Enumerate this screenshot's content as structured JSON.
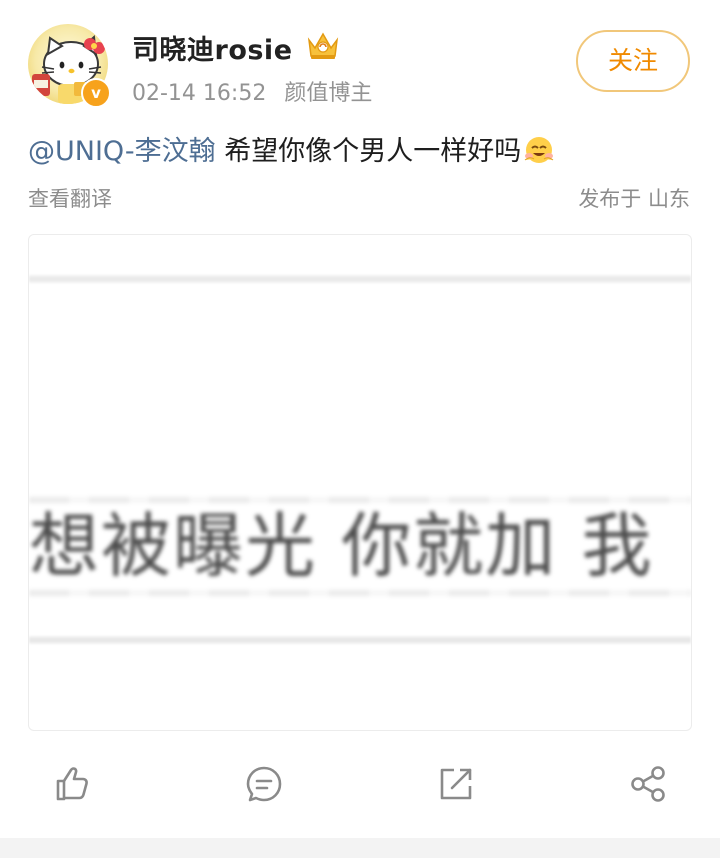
{
  "author": {
    "name": "司晓迪rosie",
    "time": "02-14 16:52",
    "tag": "颜值博主",
    "verified_mark": "v",
    "avatar_icon": "hello-kitty-avatar",
    "vip_icon": "crown-icon"
  },
  "follow_label": "关注",
  "post": {
    "mention": "@UNIQ-李汶翰",
    "text": " 希望你像个男人一样好吗",
    "emoji": "smiling-face-emoji",
    "translate_label": "查看翻译",
    "location": "发布于 山东"
  },
  "image": {
    "caption": "想被曝光 你就加 我"
  },
  "actions": {
    "like_icon": "thumbs-up-icon",
    "comment_icon": "comment-bubble-icon",
    "repost_icon": "repost-share-icon",
    "share_icon": "share-nodes-icon"
  },
  "colors": {
    "accent": "#f08a00",
    "mention": "#4e6e93",
    "muted": "#939393"
  }
}
